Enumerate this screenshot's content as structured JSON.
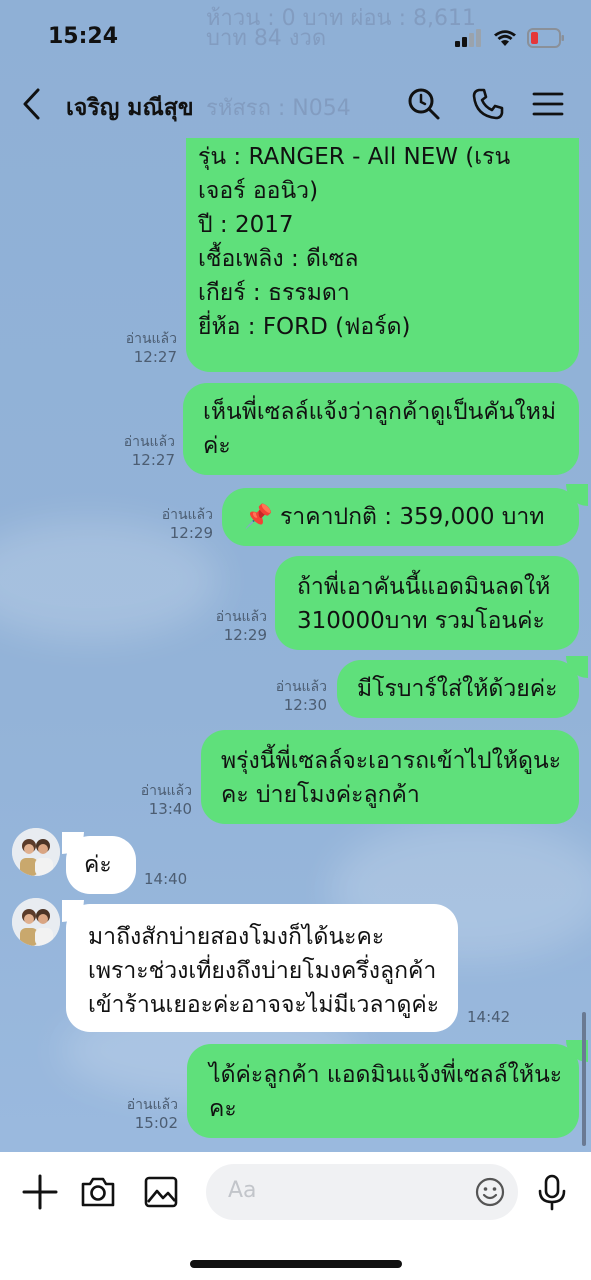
{
  "status": {
    "time": "15:24"
  },
  "header": {
    "title": "เจริญ มณีสุข",
    "ghost_line1": "ห้าวน : 0 บาท ผ่อน : 8,611",
    "ghost_line2": "บาท 84 งวด",
    "ghost_line3": "รหัสรถ : N054"
  },
  "messages": [
    {
      "id": "m1",
      "sender": "me",
      "text": "ประเภท : กระบะแคบ\n  รุ่น : RANGER - All NEW (เรน\nเจอร์ ออนิว)\n  ปี : 2017\n  เชื้อเพลิง : ดีเซล\n  เกียร์ : ธรรมดา\n  ยี่ห้อ : FORD (ฟอร์ด)",
      "read": "อ่านแล้ว",
      "time": "12:27"
    },
    {
      "id": "m2",
      "sender": "me",
      "text": "เห็นพี่เซลล์แจ้งว่าลูกค้าดูเป็นคันใหม่\nค่ะ",
      "read": "อ่านแล้ว",
      "time": "12:27"
    },
    {
      "id": "m3",
      "sender": "me",
      "text": "ราคาปกติ  : 359,000 บาท",
      "read": "อ่านแล้ว",
      "time": "12:29"
    },
    {
      "id": "m4",
      "sender": "me",
      "text": "ถ้าพี่เอาคันนี้แอดมินลดให้\n310000บาท รวมโอนค่ะ",
      "read": "อ่านแล้ว",
      "time": "12:29"
    },
    {
      "id": "m5",
      "sender": "me",
      "text": "มีโรบาร์ใส่ให้ด้วยค่ะ",
      "read": "อ่านแล้ว",
      "time": "12:30"
    },
    {
      "id": "m6",
      "sender": "me",
      "text": "พรุ่งนี้พี่เซลล์จะเอารถเข้าไปให้ดูนะ\nคะ บ่ายโมงค่ะลูกค้า",
      "read": "อ่านแล้ว",
      "time": "13:40"
    },
    {
      "id": "m7",
      "sender": "them",
      "text": "ค่ะ",
      "time": "14:40"
    },
    {
      "id": "m8",
      "sender": "them",
      "text": "มาถึงสักบ่ายสองโมงก็ได้นะคะ\nเพราะช่วงเที่ยงถึงบ่ายโมงครึ่งลูกค้า\nเข้าร้านเยอะค่ะอาจจะไม่มีเวลาดูค่ะ",
      "time": "14:42"
    },
    {
      "id": "m9",
      "sender": "me",
      "text": "ได้ค่ะลูกค้า แอดมินแจ้งพี่เซลล์ให้นะ\nคะ",
      "read": "อ่านแล้ว",
      "time": "15:02"
    }
  ],
  "composer": {
    "placeholder": "Aa"
  },
  "colors": {
    "outgoing": "#5fe07b",
    "incoming": "#ffffff",
    "background": "#93b3d8"
  }
}
